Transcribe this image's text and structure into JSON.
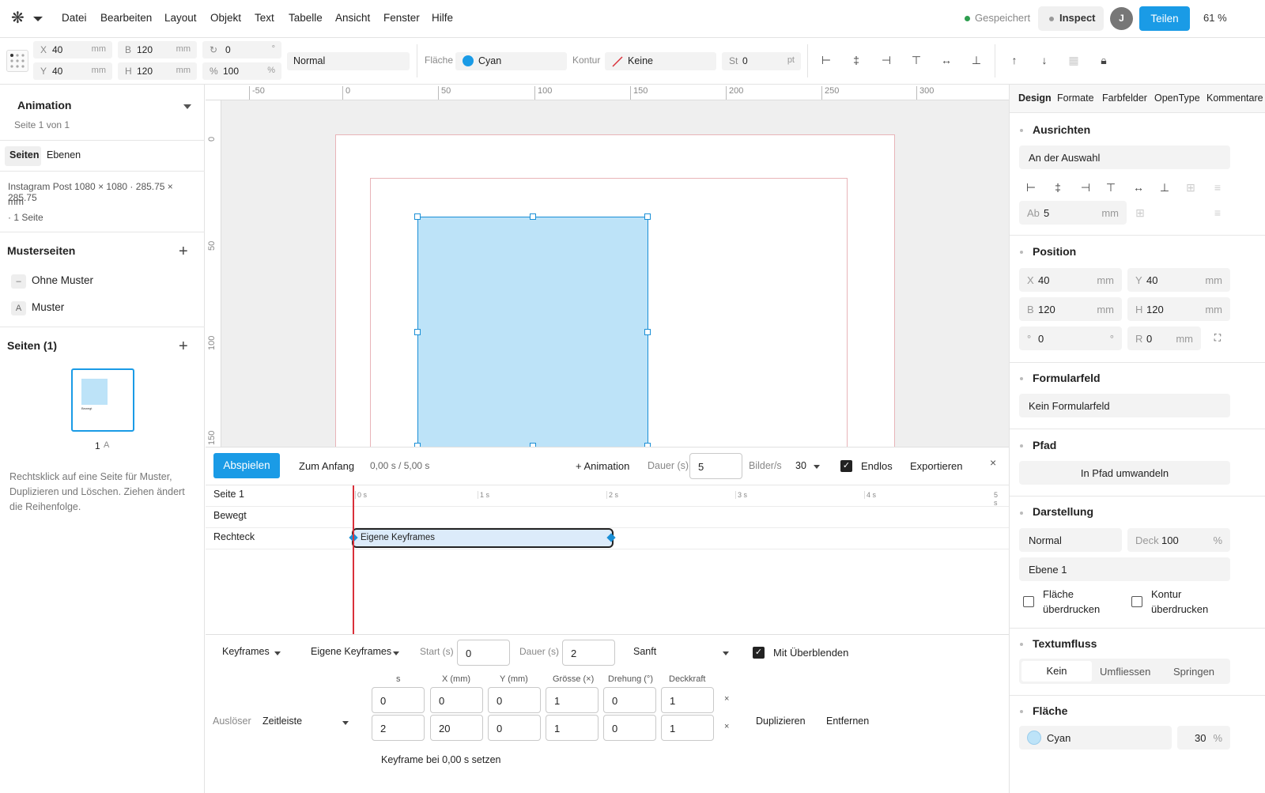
{
  "menubar": {
    "items": [
      "Datei",
      "Bearbeiten",
      "Layout",
      "Objekt",
      "Text",
      "Tabelle",
      "Ansicht",
      "Fenster",
      "Hilfe"
    ],
    "saved_label": "Gespeichert",
    "inspect_label": "Inspect",
    "avatar_initial": "J",
    "share_label": "Teilen",
    "zoom": "61 %"
  },
  "toolbar": {
    "x_label": "X",
    "x_value": "40",
    "x_unit": "mm",
    "y_label": "Y",
    "y_value": "40",
    "y_unit": "mm",
    "w_label": "B",
    "w_value": "120",
    "w_unit": "mm",
    "h_label": "H",
    "h_value": "120",
    "h_unit": "mm",
    "rotation_value": "0",
    "rotation_unit": "°",
    "scale_label": "%",
    "scale_value": "100",
    "scale_unit": "%",
    "blend_mode": "Normal",
    "fill_label": "Fläche",
    "fill_value": "Cyan",
    "stroke_label": "Kontur",
    "stroke_value": "Keine",
    "stroke_width_label": "St",
    "stroke_width_value": "0",
    "stroke_width_unit": "pt"
  },
  "left": {
    "panel_title": "Animation",
    "page_info": "Seite 1 von 1",
    "tabs": [
      "Seiten",
      "Ebenen"
    ],
    "doc_line1": "Instagram Post 1080 × 1080 · 285.75 × 285.75",
    "doc_line2": "mm",
    "doc_line3": "· 1 Seite",
    "master_title": "Musterseiten",
    "masters": [
      {
        "badge": "–",
        "label": "Ohne Muster"
      },
      {
        "badge": "A",
        "label": "Muster"
      }
    ],
    "pages_title": "Seiten (1)",
    "thumb_label": "Bewegt",
    "page_number": "1",
    "page_master": "A",
    "hint_line1": "Rechtsklick auf eine Seite für Muster,",
    "hint_line2": "Duplizieren und Löschen. Ziehen ändert",
    "hint_line3": "die Reihenfolge."
  },
  "ruler": {
    "h_ticks": [
      "-50",
      "0",
      "50",
      "100",
      "150",
      "200",
      "250",
      "300"
    ],
    "v_ticks": [
      "0",
      "50",
      "100",
      "150"
    ]
  },
  "timeline": {
    "play_label": "Abspielen",
    "to_start_label": "Zum Anfang",
    "time_display": "0,00 s / 5,00 s",
    "add_anim_label": "+ Animation",
    "duration_label": "Dauer (s)",
    "duration_value": "5",
    "fps_label": "Bilder/s",
    "fps_value": "30",
    "loop_label": "Endlos",
    "export_label": "Exportieren",
    "close_glyph": "×",
    "rows": [
      "Seite 1",
      "Bewegt",
      "Rechteck"
    ],
    "time_ticks": [
      "0 s",
      "1 s",
      "2 s",
      "3 s",
      "4 s",
      "5 s"
    ],
    "clip_label": "Eigene Keyframes",
    "keyframes_dropdown": "Keyframes",
    "preset_dropdown": "Eigene Keyframes",
    "start_label": "Start (s)",
    "start_value": "0",
    "dur2_label": "Dauer (s)",
    "dur2_value": "2",
    "easing_value": "Sanft",
    "crossfade_label": "Mit Überblenden",
    "trigger_label": "Auslöser",
    "trigger_value": "Zeitleiste",
    "table_headers": [
      "s",
      "X (mm)",
      "Y (mm)",
      "Grösse (×)",
      "Drehung (°)",
      "Deckkraft"
    ],
    "table_rows": [
      [
        "0",
        "0",
        "0",
        "1",
        "0",
        "1"
      ],
      [
        "2",
        "20",
        "0",
        "1",
        "0",
        "1"
      ]
    ],
    "duplicate_label": "Duplizieren",
    "remove_label": "Entfernen",
    "set_keyframe_label": "Keyframe bei 0,00 s setzen"
  },
  "right": {
    "tabs": [
      "Design",
      "Formate",
      "Farbfelder",
      "OpenType",
      "Kommentare"
    ],
    "align_title": "Ausrichten",
    "align_target": "An der Auswahl",
    "spacing_label": "Ab",
    "spacing_value": "5",
    "spacing_unit": "mm",
    "position_title": "Position",
    "pos_x_label": "X",
    "pos_x": "40",
    "pos_x_unit": "mm",
    "pos_y_label": "Y",
    "pos_y": "40",
    "pos_y_unit": "mm",
    "pos_w_label": "B",
    "pos_w": "120",
    "pos_w_unit": "mm",
    "pos_h_label": "H",
    "pos_h": "120",
    "pos_h_unit": "mm",
    "pos_rot_label": "°",
    "pos_rot": "0",
    "pos_rot_unit": "°",
    "pos_r_label": "R",
    "pos_r": "0",
    "pos_r_unit": "mm",
    "form_title": "Formularfeld",
    "form_value": "Kein Formularfeld",
    "path_title": "Pfad",
    "path_button": "In Pfad umwandeln",
    "display_title": "Darstellung",
    "display_blend": "Normal",
    "opacity_label": "Deck",
    "opacity_value": "100",
    "opacity_unit": "%",
    "layer_value": "Ebene 1",
    "overprint_fill_1": "Fläche",
    "overprint_fill_2": "überdrucken",
    "overprint_stroke_1": "Kontur",
    "overprint_stroke_2": "überdrucken",
    "wrap_title": "Textumfluss",
    "wrap_options": [
      "Kein",
      "Umfliessen",
      "Springen"
    ],
    "fill_title": "Fläche",
    "fill_color_name": "Cyan",
    "fill_tint": "30",
    "fill_tint_unit": "%"
  },
  "colors": {
    "accent": "#1a9be6",
    "shape_fill": "#bde3f8",
    "shape_stroke": "#1a8fd6",
    "playhead": "#d9303a",
    "saved_dot": "#2e9e4f"
  }
}
